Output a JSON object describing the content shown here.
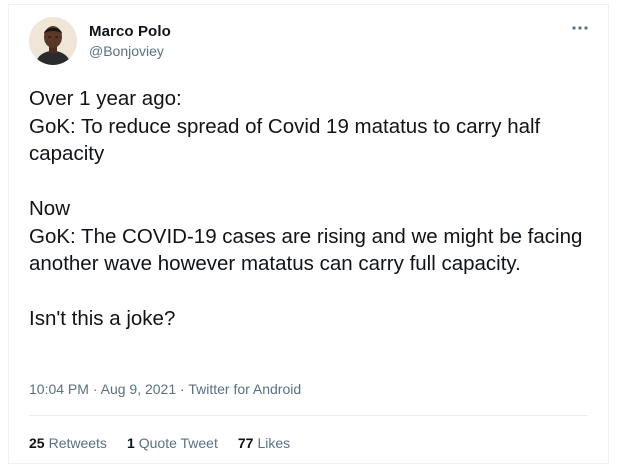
{
  "tweet": {
    "author": {
      "display_name": "Marco Polo",
      "handle": "@Bonjoviey"
    },
    "more_icon": "more-horizontal-icon",
    "text": {
      "p1_line1": "Over 1 year ago:",
      "p1_line2": "GoK: To reduce spread of Covid 19 matatus to carry half capacity",
      "p2_line1": "Now",
      "p2_line2": "GoK: The COVID-19 cases are rising and we might be facing another wave however matatus can carry full capacity.",
      "p3_line1": "Isn't this a joke?"
    },
    "meta": {
      "time": "10:04 PM",
      "separator": " · ",
      "date": "Aug 9, 2021",
      "source": "Twitter for Android"
    },
    "stats": {
      "retweets_count": "25",
      "retweets_label": "Retweets",
      "quotes_count": "1",
      "quotes_label": "Quote Tweet",
      "likes_count": "77",
      "likes_label": "Likes"
    },
    "colors": {
      "text": "#0f1419",
      "secondary": "#5b7083",
      "border": "#ebeef0"
    }
  }
}
